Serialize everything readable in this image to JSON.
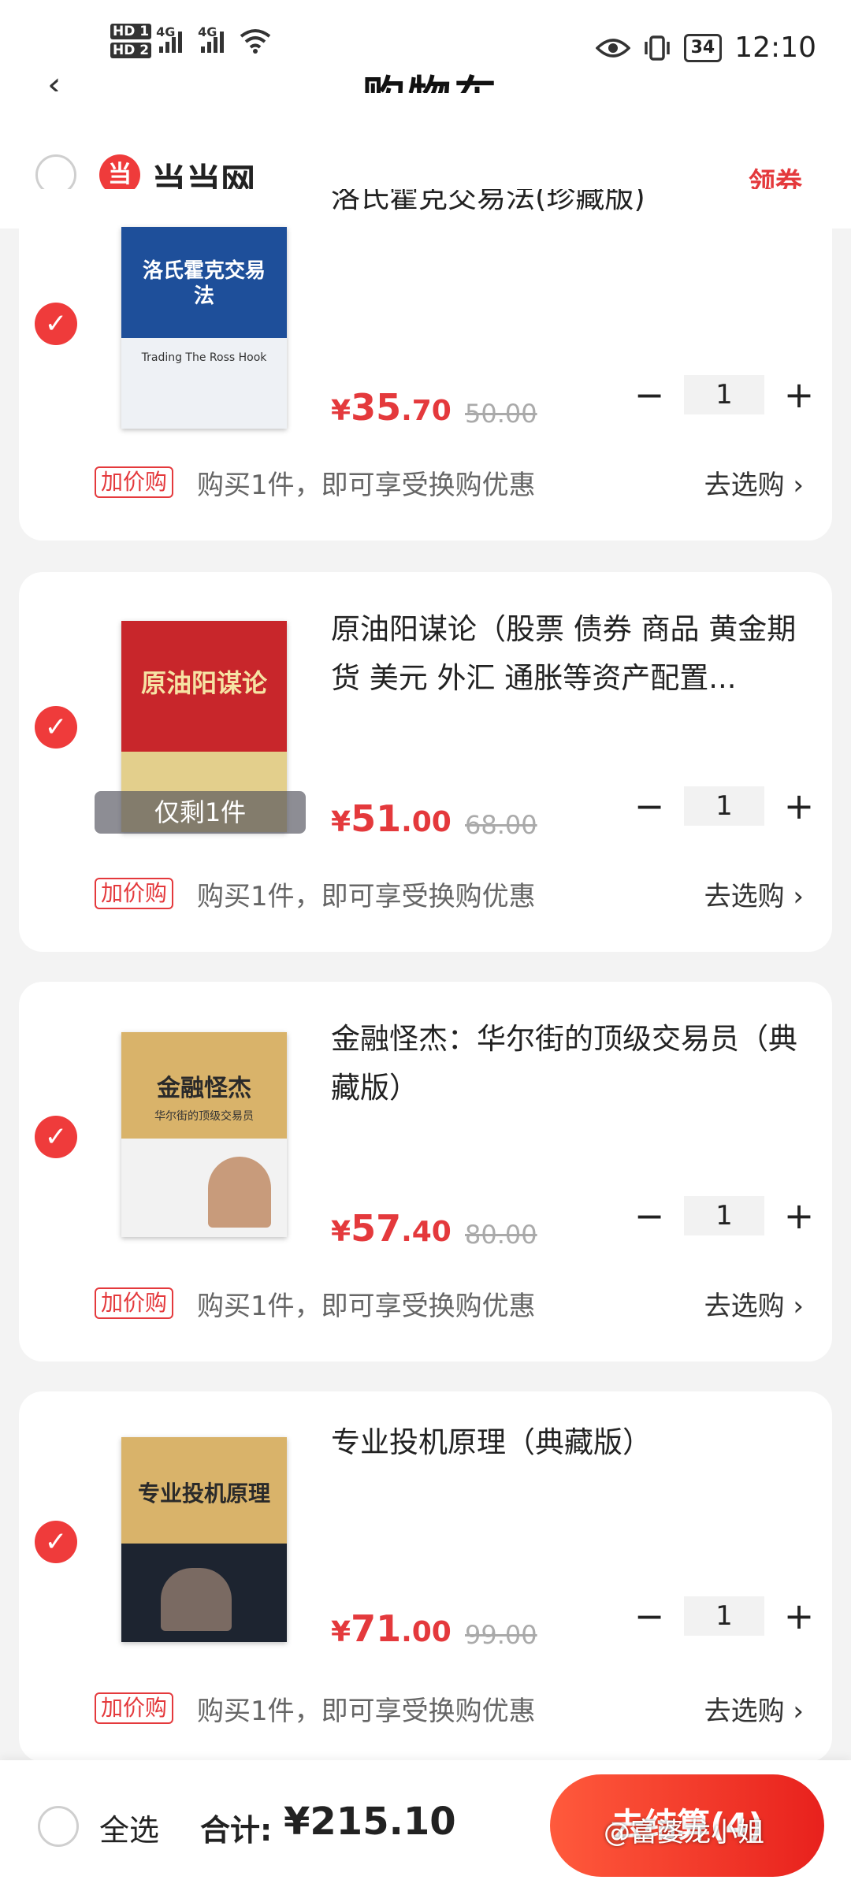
{
  "status_bar": {
    "hd1": "HD 1",
    "hd2": "HD 2",
    "net1": "4G",
    "net2": "4G",
    "battery": "34",
    "time": "12:10"
  },
  "nav": {
    "title_partial": "购物车"
  },
  "shop": {
    "name": "当当网",
    "logo_glyph": "当",
    "coupon_label": "领券"
  },
  "items": [
    {
      "title": "洛氏霍克交易法(珍藏版)",
      "cover_title": "洛氏霍克交易法",
      "cover_sub": "Trading The Ross Hook",
      "price_currency": "¥",
      "price_int": "35",
      "price_dec": ".70",
      "original_price": "50.00",
      "quantity": "1",
      "promo_tag": "加价购",
      "promo_text": "购买1件，即可享受换购优惠",
      "select_link": "去选购"
    },
    {
      "title": "原油阳谋论（股票 债券 商品 黄金期货 美元 外汇 通胀等资产配置...",
      "cover_title": "原油阳谋论",
      "stock_badge": "仅剩1件",
      "price_currency": "¥",
      "price_int": "51",
      "price_dec": ".00",
      "original_price": "68.00",
      "quantity": "1",
      "promo_tag": "加价购",
      "promo_text": "购买1件，即可享受换购优惠",
      "select_link": "去选购"
    },
    {
      "title": "金融怪杰：华尔街的顶级交易员（典藏版）",
      "cover_title": "金融怪杰",
      "cover_sub": "华尔街的顶级交易员",
      "price_currency": "¥",
      "price_int": "57",
      "price_dec": ".40",
      "original_price": "80.00",
      "quantity": "1",
      "promo_tag": "加价购",
      "promo_text": "购买1件，即可享受换购优惠",
      "select_link": "去选购"
    },
    {
      "title": "专业投机原理（典藏版）",
      "cover_title": "专业投机原理",
      "price_currency": "¥",
      "price_int": "71",
      "price_dec": ".00",
      "original_price": "99.00",
      "quantity": "1",
      "promo_tag": "加价购",
      "promo_text": "购买1件，即可享受换购优惠",
      "select_link": "去选购"
    }
  ],
  "qty_controls": {
    "minus": "−",
    "plus": "+"
  },
  "bottom": {
    "select_all": "全选",
    "total_label": "合计:",
    "total_amount": "¥215.10",
    "checkout": "去结算(4)",
    "watermark": "@富婆龙小姐"
  },
  "colors": {
    "accent": "#e4393c",
    "check": "#ef3b3b"
  }
}
